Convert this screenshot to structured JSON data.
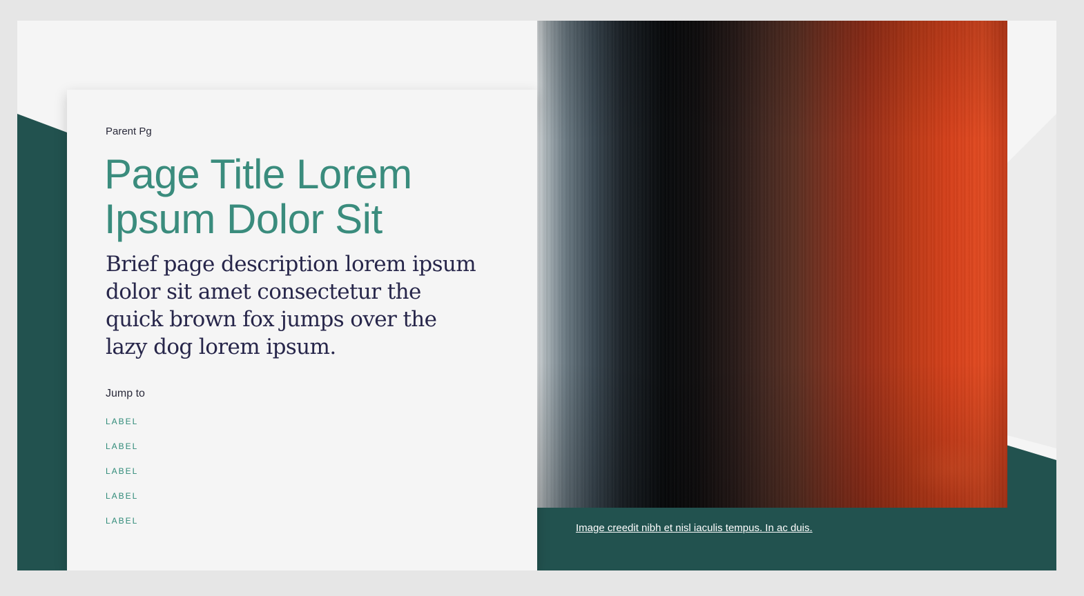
{
  "header": {
    "breadcrumb": "Parent Pg",
    "title": "Page Title Lorem Ipsum Dolor Sit",
    "description": "Brief page description lorem ipsum dolor sit amet consectetur the quick brown fox jumps over the lazy dog lorem ipsum."
  },
  "jump_to": {
    "label": "Jump to",
    "items": [
      {
        "label": "LABEL"
      },
      {
        "label": "LABEL"
      },
      {
        "label": "LABEL"
      },
      {
        "label": "LABEL"
      },
      {
        "label": "LABEL"
      }
    ]
  },
  "hero": {
    "image_description": "",
    "credit": "Image creedit nibh et nisl iaculis tempus. In ac duis."
  },
  "colors": {
    "page_background": "#e6e6e6",
    "panel_background": "#f5f5f5",
    "accent_dark_green": "#22524f",
    "title_teal": "#3a8c7d",
    "link_teal": "#2f8a78",
    "body_navy": "#27264a"
  }
}
